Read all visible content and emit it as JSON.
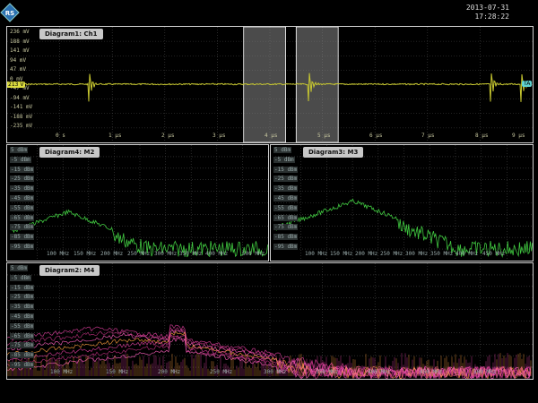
{
  "status": {
    "date": "2013-07-31",
    "time": "17:28:22",
    "logo": "rohde-schwarz-logo"
  },
  "d1": {
    "title": "Diagram1: Ch1",
    "y_labels": [
      "236 mV",
      "188 mV",
      "141 mV",
      "94 mV",
      "47 mV",
      "0 mV",
      "-47 mV",
      "-94 mV",
      "-141 mV",
      "-188 mV",
      "-235 mV"
    ],
    "x_labels": [
      "0 s",
      "1 µs",
      "2 µs",
      "3 µs",
      "4 µs",
      "5 µs",
      "6 µs",
      "7 µs",
      "8 µs",
      "9 µs"
    ],
    "left_marker": "213 V",
    "right_marker": "TA",
    "gates": [
      [
        4.5,
        5.3
      ],
      [
        5.5,
        6.3
      ]
    ]
  },
  "d4": {
    "title": "Diagram4: M2",
    "y_labels": [
      "5 dBm",
      "-5 dBm",
      "-15 dBm",
      "-25 dBm",
      "-35 dBm",
      "-45 dBm",
      "-55 dBm",
      "-65 dBm",
      "-75 dBm",
      "-85 dBm",
      "-95 dBm"
    ],
    "x_labels": [
      "100 MHz",
      "150 MHz",
      "200 MHz",
      "250 MHz",
      "300 MHz",
      "350 MHz",
      "400 MHz",
      "500 MHz"
    ]
  },
  "d3": {
    "title": "Diagram3: M3",
    "y_labels": [
      "5 dBm",
      "-5 dBm",
      "-15 dBm",
      "-25 dBm",
      "-35 dBm",
      "-45 dBm",
      "-55 dBm",
      "-65 dBm",
      "-75 dBm",
      "-85 dBm",
      "-95 dBm"
    ],
    "x_labels": [
      "100 MHz",
      "150 MHz",
      "200 MHz",
      "250 MHz",
      "300 MHz",
      "350 MHz",
      "400 MHz",
      "450 MHz"
    ]
  },
  "d2": {
    "title": "Diagram2: M4",
    "y_labels": [
      "5 dBm",
      "-5 dBm",
      "-15 dBm",
      "-25 dBm",
      "-35 dBm",
      "-45 dBm",
      "-55 dBm",
      "-65 dBm",
      "-75 dBm",
      "-85 dBm",
      "-95 dBm"
    ],
    "x_labels": [
      "100 MHz",
      "150 MHz",
      "200 MHz",
      "250 MHz",
      "300 MHz",
      "350 MHz",
      "400 MHz",
      "450 MHz",
      "500 MHz"
    ]
  },
  "colors": {
    "trace_yellow": "#c8c830",
    "spectrum_green": "#40c840",
    "spectrum_magenta": "#e040a0",
    "spectrum_orange": "#ffa040"
  }
}
